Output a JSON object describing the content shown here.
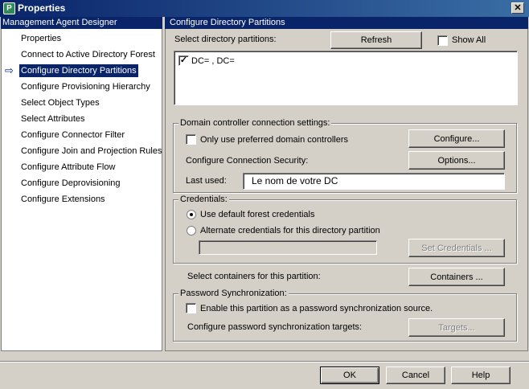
{
  "window": {
    "title": "Properties",
    "close_glyph": "✕",
    "icon": "app-icon"
  },
  "nav": {
    "header": "Management Agent Designer",
    "current_marker": "⇨",
    "items": [
      {
        "label": "Properties"
      },
      {
        "label": "Connect to Active Directory Forest"
      },
      {
        "label": "Configure Directory Partitions",
        "selected": true
      },
      {
        "label": "Configure Provisioning Hierarchy"
      },
      {
        "label": "Select Object Types"
      },
      {
        "label": "Select Attributes"
      },
      {
        "label": "Configure Connector Filter"
      },
      {
        "label": "Configure Join and Projection Rules"
      },
      {
        "label": "Configure Attribute Flow"
      },
      {
        "label": "Configure Deprovisioning"
      },
      {
        "label": "Configure Extensions"
      }
    ]
  },
  "main": {
    "header": "Configure Directory Partitions",
    "select_label": "Select directory partitions:",
    "refresh_label": "Refresh",
    "show_all_label": "Show All",
    "show_all_checked": false,
    "partitions": [
      {
        "label": "DC=    , DC=",
        "checked": true
      }
    ],
    "dc_group": {
      "title": "Domain controller connection settings:",
      "preferred_label": "Only use preferred domain controllers",
      "preferred_checked": false,
      "configure_label": "Configure...",
      "security_label": "Configure Connection Security:",
      "options_label": "Options...",
      "last_used_label": "Last used:",
      "last_used_value": "Le nom de votre DC"
    },
    "credentials": {
      "title": "Credentials:",
      "default_label": "Use default forest credentials",
      "alternate_label": "Alternate credentials for this directory partition",
      "selected": "default",
      "set_credentials_label": "Set Credentials ..."
    },
    "containers": {
      "label": "Select containers for this partition:",
      "button_label": "Containers ..."
    },
    "password_sync": {
      "title": "Password Synchronization:",
      "enable_label": "Enable this partition as a password synchronization source.",
      "enable_checked": false,
      "targets_label": "Configure password synchronization targets:",
      "targets_button_label": "Targets..."
    }
  },
  "footer": {
    "ok_label": "OK",
    "cancel_label": "Cancel",
    "help_label": "Help"
  }
}
